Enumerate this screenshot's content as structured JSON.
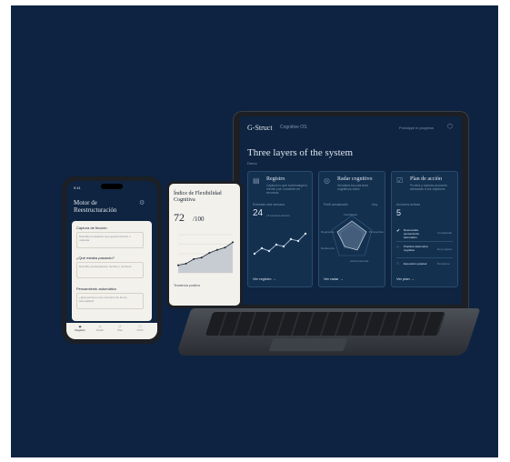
{
  "laptop": {
    "brand": "G-Struct",
    "product": "Cognitive OS",
    "nav_right": "Prototype in progress",
    "heading": "Three layers of the system",
    "sub": "Demo",
    "cards": [
      {
        "title": "Registro",
        "desc": "Captura lo que sobrecarga tu mente y se convierte en recursos",
        "metric_label": "Entradas este semana",
        "metric_value": "24",
        "metric_note": "+5 semana anterior",
        "footer": "Ver registro →"
      },
      {
        "title": "Radar cognitivo",
        "desc": "Visualiza tus patrones cognitivos clave",
        "metric_label": "Perfil actualizado",
        "metric_note": "Hoy",
        "radar_labels": [
          "Flexibilidad",
          "Resiliencia",
          "Perspectiva",
          "Autoconciencia",
          "Regulación"
        ],
        "footer": "Ver radar →"
      },
      {
        "title": "Plan de acción",
        "desc": "Prueba y ejecuta acciones alineadas a tus objetivos",
        "metric_label": "Acciones activas",
        "metric_value": "5",
        "actions": [
          {
            "label": "Reencuadre pensamiento automático",
            "status": "Completado"
          },
          {
            "label": "Practicar alternativa cognitiva",
            "status": "En progreso"
          },
          {
            "label": "Exposición gradual",
            "status": "Pendiente"
          }
        ],
        "footer": "Ver plan →"
      }
    ]
  },
  "tablet": {
    "title": "Índice de Flexibilidad Cognitiva",
    "score": "72",
    "score_total": "/100",
    "legend": "Tendencia positiva",
    "chart_values": [
      40,
      42,
      48,
      50,
      56,
      60,
      63,
      70
    ]
  },
  "phone": {
    "time": "9:41",
    "title": "Motor de Reestructuración",
    "section1": "Captura de fricción",
    "placeholder1": "Describe la situación que generó fricción o malestar",
    "section2": "¿Qué estaba pasando?",
    "placeholder2": "Describe pensamientos, hechos o contexto",
    "section3": "Pensamiento automático",
    "placeholder3": "¿Qué pensé en ese momento de forma automática?",
    "tabs": [
      "Registro",
      "Radar",
      "Plan",
      "Perfil"
    ]
  }
}
